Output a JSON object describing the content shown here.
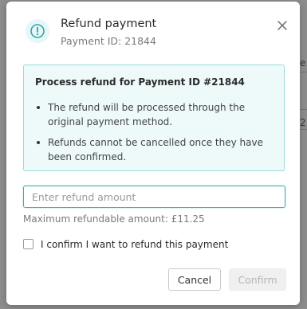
{
  "backdrop": {
    "fragment_1": "e",
    "fragment_2": "2"
  },
  "modal": {
    "title": "Refund payment",
    "subtitle": "Payment ID: 21844",
    "icon": "exclamation-circle-icon",
    "close_icon": "close-icon"
  },
  "info": {
    "title": "Process refund for Payment ID #21844",
    "items": [
      "The refund will be processed through the original payment method.",
      "Refunds cannot be cancelled once they have been confirmed."
    ]
  },
  "amount": {
    "placeholder": "Enter refund amount",
    "value": "",
    "max_text": "Maximum refundable amount: £11.25"
  },
  "confirm": {
    "label": "I confirm I want to refund this payment",
    "checked": false
  },
  "buttons": {
    "cancel": "Cancel",
    "confirm": "Confirm"
  },
  "colors": {
    "accent": "#3ab0b6",
    "info_bg": "#eef9fa",
    "info_border": "#9adadd",
    "disabled_text": "#b5b5b5"
  }
}
